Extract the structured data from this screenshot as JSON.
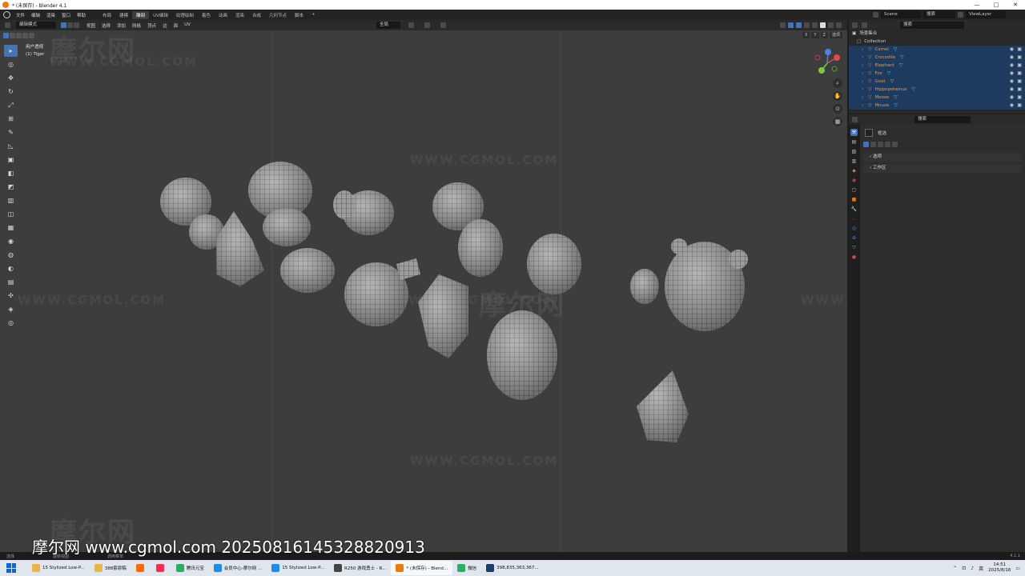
{
  "window": {
    "title": "* (未保存) - Blender 4.1",
    "controls": [
      "—",
      "□",
      "✕"
    ]
  },
  "menu": {
    "items": [
      "文件",
      "编辑",
      "渲染",
      "窗口",
      "帮助"
    ],
    "workspaces": [
      "布局",
      "建模",
      "雕刻",
      "UV编辑",
      "纹理绘制",
      "着色",
      "动画",
      "渲染",
      "合成",
      "几何节点",
      "脚本",
      "+"
    ],
    "active_workspace": 2,
    "scene": "Scene",
    "search_placeholder": "搜索",
    "view_layer": "ViewLayer"
  },
  "viewport_header": {
    "mode": "编辑模式",
    "menus": [
      "视图",
      "选择",
      "添加",
      "网格",
      "顶点",
      "边",
      "面",
      "UV"
    ],
    "transform_orientation": "全局",
    "xyz": [
      "X",
      "Y",
      "Z"
    ],
    "options": "选项"
  },
  "viewport": {
    "view_name": "用户透视",
    "object_info": "(1) Tiger",
    "tools": [
      "▸",
      "◎",
      "✥",
      "↻",
      "⤢",
      "⊞",
      "✎",
      "◺",
      "▣",
      "◧",
      "◩",
      "▥",
      "◫",
      "▦",
      "◉",
      "◍",
      "◐",
      "▤",
      "✣",
      "◈",
      "◎"
    ],
    "nav_icons": [
      "⌕",
      "✋",
      "⊙",
      "▦"
    ]
  },
  "outliner": {
    "header_title": "场景集合",
    "collection": "Collection",
    "search_placeholder": "搜索",
    "items": [
      "Camel",
      "Crocodile",
      "Elephant",
      "Fox",
      "Goat",
      "Hippopotamus",
      "Moose",
      "Mouse"
    ]
  },
  "properties": {
    "search_placeholder": "搜索",
    "active_label": "框选",
    "panels": [
      "选项",
      "工作区"
    ]
  },
  "statusbar": {
    "items": [
      "选择",
      "旋转视图",
      "调用菜单"
    ],
    "version": "4.1.1"
  },
  "watermarks": {
    "cn": "摩尔网",
    "en": "WWW.CGMOL.COM",
    "site": "摩尔网 www.cgmol.com 20250816145328820913"
  },
  "taskbar": {
    "tasks": [
      {
        "label": "15 Stylized Low-P...",
        "color": "#e8b54a"
      },
      {
        "label": "388套原稿",
        "color": "#e8b54a"
      },
      {
        "label": "",
        "color": "#ff6a00"
      },
      {
        "label": "",
        "color": "#ff2b55"
      },
      {
        "label": "腾讯元宝",
        "color": "#2aae67"
      },
      {
        "label": "会员中心-摩尔网 ...",
        "color": "#1c8ce6"
      },
      {
        "label": "15 Stylized Low-P...",
        "color": "#1c8ce6"
      },
      {
        "label": "R250 游戏勇士 - R...",
        "color": "#444444"
      },
      {
        "label": "* (未保存) - Blend...",
        "color": "#e87d0d"
      },
      {
        "label": "微信",
        "color": "#2aae67"
      },
      {
        "label": "398,835,363,367...",
        "color": "#1e3d6b"
      }
    ],
    "active_task": 8,
    "lang": "英",
    "time": "14:51",
    "date": "2025/8/16"
  },
  "colors": {
    "accent": "#4772b3",
    "object_orange": "#e49b48",
    "mesh_teal": "#4ec9b0",
    "viewport_bg": "#3d3d3d"
  },
  "chart_data": []
}
